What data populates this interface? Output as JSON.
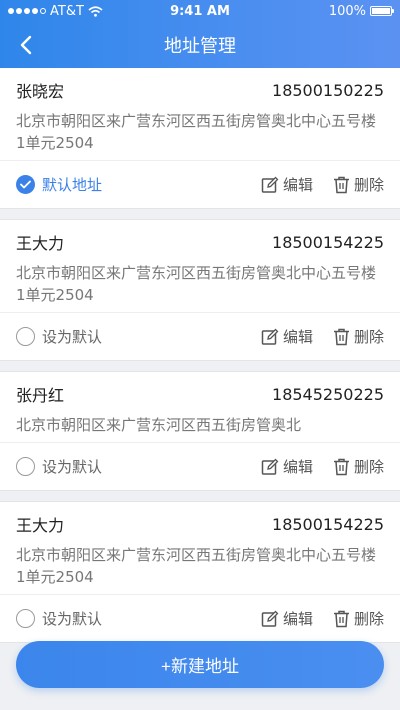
{
  "status_bar": {
    "carrier": "AT&T",
    "time": "9:41 AM",
    "battery": "100%"
  },
  "header": {
    "title": "地址管理"
  },
  "addresses": [
    {
      "name": "张晓宏",
      "phone": "18500150225",
      "address": "北京市朝阳区来广营东河区西五街房管奥北中心五号楼1单元2504",
      "default_label": "默认地址",
      "is_default": true
    },
    {
      "name": "王大力",
      "phone": "18500154225",
      "address": "北京市朝阳区来广营东河区西五街房管奥北中心五号楼1单元2504",
      "default_label": "设为默认",
      "is_default": false
    },
    {
      "name": "张丹红",
      "phone": "18545250225",
      "address": "北京市朝阳区来广营东河区西五街房管奥北",
      "default_label": "设为默认",
      "is_default": false
    },
    {
      "name": "王大力",
      "phone": "18500154225",
      "address": "北京市朝阳区来广营东河区西五街房管奥北中心五号楼1单元2504",
      "default_label": "设为默认",
      "is_default": false
    }
  ],
  "actions": {
    "edit": "编辑",
    "delete": "删除"
  },
  "add_button": "+新建地址",
  "colors": {
    "accent": "#3b82e8",
    "header_start": "#2f86ea",
    "header_end": "#5b92f2"
  }
}
